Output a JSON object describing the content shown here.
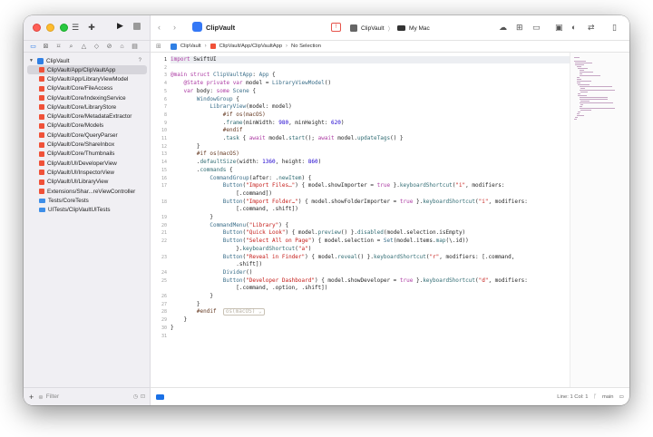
{
  "sidebar": {
    "project": {
      "name": "ClipVault",
      "badge": "?"
    },
    "files": [
      "ClipVault/App/ClipVaultApp",
      "ClipVault/App/LibraryViewModel",
      "ClipVault/Core/FileAccess",
      "ClipVault/Core/IndexingService",
      "ClipVault/Core/LibraryStore",
      "ClipVault/Core/MetadataExtractor",
      "ClipVault/Core/Models",
      "ClipVault/Core/QueryParser",
      "ClipVault/Core/ShareInbox",
      "ClipVault/Core/Thumbnails",
      "ClipVault/UI/DeveloperView",
      "ClipVault/UI/InspectorView",
      "ClipVault/UI/LibraryView",
      "Extensions/Shar...reViewController",
      "Tests/CoreTests",
      "UITests/ClipVaultUITests"
    ],
    "folder_rows": [
      14,
      15
    ],
    "selected_index": 0,
    "filter_placeholder": "Filter"
  },
  "toolbar": {
    "title": "ClipVault",
    "scheme": "ClipVault",
    "destination": "My Mac"
  },
  "jumpbar": {
    "crumbs": [
      "ClipVault",
      "ClipVault/App/ClipVaultApp",
      "No Selection"
    ]
  },
  "editor": {
    "current_line": 1,
    "lines": [
      [
        [
          "kw",
          "import"
        ],
        [
          "pl",
          " SwiftUI"
        ]
      ],
      [],
      [
        [
          "kw",
          "@main"
        ],
        [
          "pl",
          " "
        ],
        [
          "kw",
          "struct"
        ],
        [
          "pl",
          " "
        ],
        [
          "ty",
          "ClipVaultApp"
        ],
        [
          "pl",
          ": "
        ],
        [
          "ty",
          "App"
        ],
        [
          "pl",
          " {"
        ]
      ],
      [
        [
          "pl",
          "    "
        ],
        [
          "kw",
          "@State"
        ],
        [
          "pl",
          " "
        ],
        [
          "kw",
          "private"
        ],
        [
          "pl",
          " "
        ],
        [
          "kw",
          "var"
        ],
        [
          "pl",
          " model = "
        ],
        [
          "ty",
          "LibraryViewModel"
        ],
        [
          "pl",
          "()"
        ]
      ],
      [
        [
          "pl",
          "    "
        ],
        [
          "kw",
          "var"
        ],
        [
          "pl",
          " body: "
        ],
        [
          "kw",
          "some"
        ],
        [
          "pl",
          " "
        ],
        [
          "ty",
          "Scene"
        ],
        [
          "pl",
          " {"
        ]
      ],
      [
        [
          "pl",
          "        "
        ],
        [
          "ty",
          "WindowGroup"
        ],
        [
          "pl",
          " {"
        ]
      ],
      [
        [
          "pl",
          "            "
        ],
        [
          "ty",
          "LibraryView"
        ],
        [
          "pl",
          "(model: model)"
        ]
      ],
      [
        [
          "pl",
          "                "
        ],
        [
          "dir",
          "#if os(macOS)"
        ]
      ],
      [
        [
          "pl",
          "                ."
        ],
        [
          "fn",
          "frame"
        ],
        [
          "pl",
          "(minWidth: "
        ],
        [
          "num",
          "980"
        ],
        [
          "pl",
          ", minHeight: "
        ],
        [
          "num",
          "620"
        ],
        [
          "pl",
          ")"
        ]
      ],
      [
        [
          "pl",
          "                "
        ],
        [
          "dir",
          "#endif"
        ]
      ],
      [
        [
          "pl",
          "                ."
        ],
        [
          "fn",
          "task"
        ],
        [
          "pl",
          " { "
        ],
        [
          "kw",
          "await"
        ],
        [
          "pl",
          " model."
        ],
        [
          "fn",
          "start"
        ],
        [
          "pl",
          "(); "
        ],
        [
          "kw",
          "await"
        ],
        [
          "pl",
          " model."
        ],
        [
          "fn",
          "updateTags"
        ],
        [
          "pl",
          "() }"
        ]
      ],
      [
        [
          "pl",
          "        }"
        ]
      ],
      [
        [
          "pl",
          "        "
        ],
        [
          "dir",
          "#if os(macOS)"
        ]
      ],
      [
        [
          "pl",
          "        ."
        ],
        [
          "fn",
          "defaultSize"
        ],
        [
          "pl",
          "(width: "
        ],
        [
          "num",
          "1360"
        ],
        [
          "pl",
          ", height: "
        ],
        [
          "num",
          "860"
        ],
        [
          "pl",
          ")"
        ]
      ],
      [
        [
          "pl",
          "        ."
        ],
        [
          "fn",
          "commands"
        ],
        [
          "pl",
          " {"
        ]
      ],
      [
        [
          "pl",
          "            "
        ],
        [
          "ty",
          "CommandGroup"
        ],
        [
          "pl",
          "(after: ."
        ],
        [
          "fn",
          "newItem"
        ],
        [
          "pl",
          ") {"
        ]
      ],
      [
        [
          "pl",
          "                "
        ],
        [
          "ty",
          "Button"
        ],
        [
          "pl",
          "("
        ],
        [
          "str",
          "\"Import Files…\""
        ],
        [
          "pl",
          ") { model.showImporter = "
        ],
        [
          "kw",
          "true"
        ],
        [
          "pl",
          " }."
        ],
        [
          "fn",
          "keyboardShortcut"
        ],
        [
          "pl",
          "("
        ],
        [
          "str",
          "\"i\""
        ],
        [
          "pl",
          ", modifiers:"
        ]
      ],
      [
        [
          "pl",
          "                    [.command])"
        ]
      ],
      [
        [
          "pl",
          "                "
        ],
        [
          "ty",
          "Button"
        ],
        [
          "pl",
          "("
        ],
        [
          "str",
          "\"Import Folder…\""
        ],
        [
          "pl",
          ") { model.showFolderImporter = "
        ],
        [
          "kw",
          "true"
        ],
        [
          "pl",
          " }."
        ],
        [
          "fn",
          "keyboardShortcut"
        ],
        [
          "pl",
          "("
        ],
        [
          "str",
          "\"i\""
        ],
        [
          "pl",
          ", modifiers:"
        ]
      ],
      [
        [
          "pl",
          "                    [.command, .shift])"
        ]
      ],
      [
        [
          "pl",
          "            }"
        ]
      ],
      [
        [
          "pl",
          "            "
        ],
        [
          "ty",
          "CommandMenu"
        ],
        [
          "pl",
          "("
        ],
        [
          "str",
          "\"Library\""
        ],
        [
          "pl",
          ") {"
        ]
      ],
      [
        [
          "pl",
          "                "
        ],
        [
          "ty",
          "Button"
        ],
        [
          "pl",
          "("
        ],
        [
          "str",
          "\"Quick Look\""
        ],
        [
          "pl",
          ") { model."
        ],
        [
          "fn",
          "preview"
        ],
        [
          "pl",
          "() }."
        ],
        [
          "fn",
          "disabled"
        ],
        [
          "pl",
          "(model.selection.isEmpty)"
        ]
      ],
      [
        [
          "pl",
          "                "
        ],
        [
          "ty",
          "Button"
        ],
        [
          "pl",
          "("
        ],
        [
          "str",
          "\"Select All on Page\""
        ],
        [
          "pl",
          ") { model.selection = "
        ],
        [
          "ty",
          "Set"
        ],
        [
          "pl",
          "(model.items."
        ],
        [
          "fn",
          "map"
        ],
        [
          "pl",
          "(\\.id))"
        ]
      ],
      [
        [
          "pl",
          "                    }."
        ],
        [
          "fn",
          "keyboardShortcut"
        ],
        [
          "pl",
          "("
        ],
        [
          "str",
          "\"a\""
        ],
        [
          "pl",
          ")"
        ]
      ],
      [
        [
          "pl",
          "                "
        ],
        [
          "ty",
          "Button"
        ],
        [
          "pl",
          "("
        ],
        [
          "str",
          "\"Reveal in Finder\""
        ],
        [
          "pl",
          ") { model."
        ],
        [
          "fn",
          "reveal"
        ],
        [
          "pl",
          "() }."
        ],
        [
          "fn",
          "keyboardShortcut"
        ],
        [
          "pl",
          "("
        ],
        [
          "str",
          "\"r\""
        ],
        [
          "pl",
          ", modifiers: [.command,"
        ]
      ],
      [
        [
          "pl",
          "                    .shift])"
        ]
      ],
      [
        [
          "pl",
          "                "
        ],
        [
          "ty",
          "Divider"
        ],
        [
          "pl",
          "()"
        ]
      ],
      [
        [
          "pl",
          "                "
        ],
        [
          "ty",
          "Button"
        ],
        [
          "pl",
          "("
        ],
        [
          "str",
          "\"Developer Dashboard\""
        ],
        [
          "pl",
          ") { model.showDeveloper = "
        ],
        [
          "kw",
          "true"
        ],
        [
          "pl",
          " }."
        ],
        [
          "fn",
          "keyboardShortcut"
        ],
        [
          "pl",
          "("
        ],
        [
          "str",
          "\"d\""
        ],
        [
          "pl",
          ", modifiers:"
        ]
      ],
      [
        [
          "pl",
          "                    [.command, .option, .shift])"
        ]
      ],
      [
        [
          "pl",
          "            }"
        ]
      ],
      [
        [
          "pl",
          "        }"
        ]
      ],
      [
        [
          "pl",
          "        "
        ],
        [
          "dir",
          "#endif"
        ],
        [
          "pl",
          "  "
        ],
        [
          "chip",
          "os(macOS) ⌄"
        ]
      ],
      [
        [
          "pl",
          "    }"
        ]
      ],
      [
        [
          "pl",
          "}"
        ]
      ],
      []
    ],
    "line_numbers": [
      "1",
      "2",
      "3",
      "4",
      "5",
      "6",
      "7",
      "8",
      "9",
      "10",
      "11",
      "12",
      "13",
      "14",
      "15",
      "16",
      "17",
      "",
      "18",
      "",
      "19",
      "20",
      "21",
      "22",
      "",
      "23",
      "",
      "24",
      "25",
      "",
      "26",
      "27",
      "28",
      "29",
      "30",
      "31"
    ]
  },
  "statusbar": {
    "position": "Line: 1  Col: 1",
    "branch": "main"
  }
}
